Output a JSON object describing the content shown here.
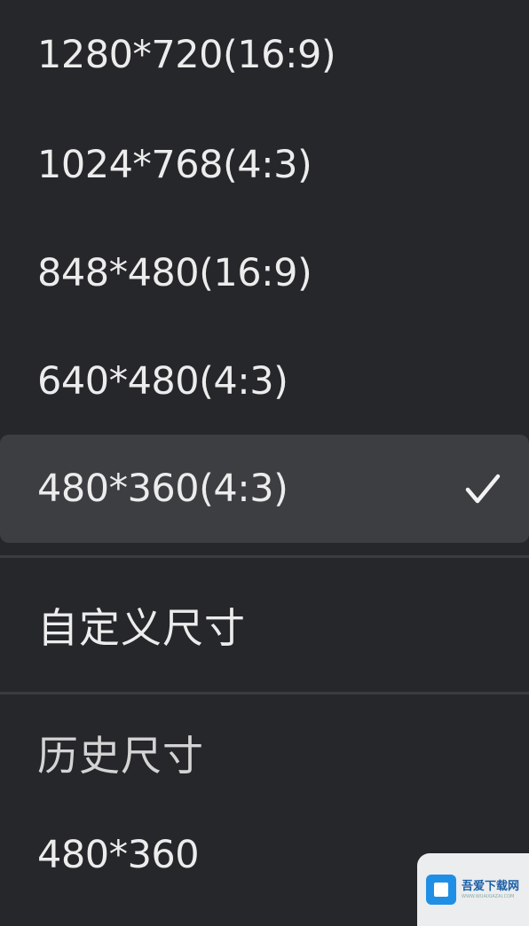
{
  "menu": {
    "resolutions": [
      {
        "label": "1280*720(16:9)"
      },
      {
        "label": "1024*768(4:3)"
      },
      {
        "label": "848*480(16:9)"
      },
      {
        "label": "640*480(4:3)"
      },
      {
        "label": "480*360(4:3)",
        "selected": true
      }
    ],
    "custom_size": "自定义尺寸",
    "history_title": "历史尺寸",
    "history_items": [
      {
        "label": "480*360"
      }
    ],
    "check_icon": "checkmark-icon"
  },
  "watermark": {
    "brand": "吾爱下载网",
    "sub": "WWW.WUAIXIAZAI.COM",
    "logo_icon": "box-logo-icon",
    "logo_color": "#1f8fe6"
  },
  "colors": {
    "background": "#26272a",
    "selected_background": "#3d3e42",
    "text": "#ececec",
    "divider": "#3b3c40"
  }
}
